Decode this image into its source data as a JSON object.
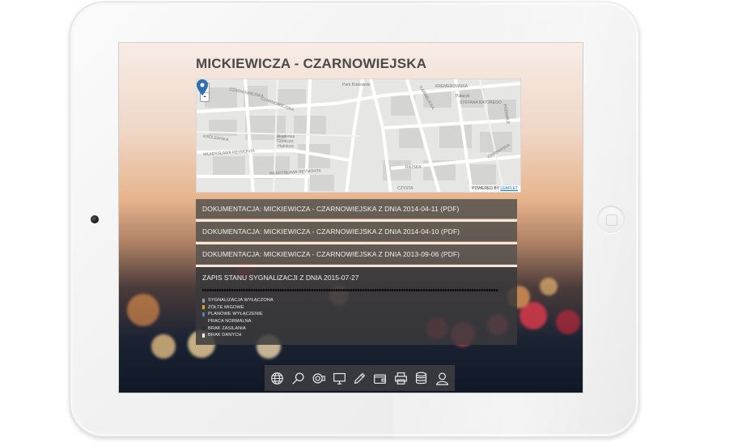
{
  "page": {
    "title": "MICKIEWICZA - CZARNOWIEJSKA"
  },
  "map": {
    "zoom_in": "+",
    "zoom_out": "-",
    "attribution_prefix": "POWERED BY",
    "attribution_link": "LEAFLET",
    "labels": [
      "Park Krakowski",
      "CZARNOWIEJSKA",
      "CZARNOWIEJSKA",
      "KREMEROWSKA",
      "KARMELICKA",
      "Pałacyk",
      "STEFANA BATOREGO",
      "Akademia Górniczo-Hutnicza",
      "WŁADYSŁAWA REYMONTA",
      "WŁADYSŁAWA REYMONTA",
      "KRÓLEWSKA",
      "CZYSTA",
      "RAJSKA",
      "GARBARSKA",
      "PODWALE"
    ]
  },
  "documents": [
    {
      "label": "DOKUMENTACJA: MICKIEWICZA - CZARNOWIEJSKA Z DNIA 2014-04-11 (PDF)"
    },
    {
      "label": "DOKUMENTACJA: MICKIEWICZA - CZARNOWIEJSKA Z DNIA 2014-04-10 (PDF)"
    },
    {
      "label": "DOKUMENTACJA: MICKIEWICZA - CZARNOWIEJSKA Z DNIA 2013-09-06 (PDF)"
    }
  ],
  "signal": {
    "title": "ZAPIS STANU SYGNALIZACJI Z DNIA 2015-07-27",
    "legend": [
      {
        "label": "SYGNALIZACJA WYŁĄCZONA",
        "color": "#9a9a9a"
      },
      {
        "label": "ŻÓŁTE MIGOWE",
        "color": "#e0a030"
      },
      {
        "label": "PLANOWE WYŁĄCZENIE",
        "color": "#5b7fb0"
      },
      {
        "label": "PRACA NORMALNA",
        "color": "#3a3a3a"
      },
      {
        "label": "BRAK ZASILANIA",
        "color": "#2e2e2e"
      },
      {
        "label": "BRAK DANYCH",
        "color": "#f5f5f5"
      }
    ]
  },
  "toolbar": {
    "icons": [
      "globe-icon",
      "search-icon",
      "camera-icon",
      "monitor-icon",
      "pencil-icon",
      "wallet-icon",
      "printer-icon",
      "database-icon",
      "user-icon"
    ]
  },
  "colors": {
    "accent_pin": "#2f6fae",
    "row_bg": "#585450",
    "separator": "#f2e8dd"
  }
}
